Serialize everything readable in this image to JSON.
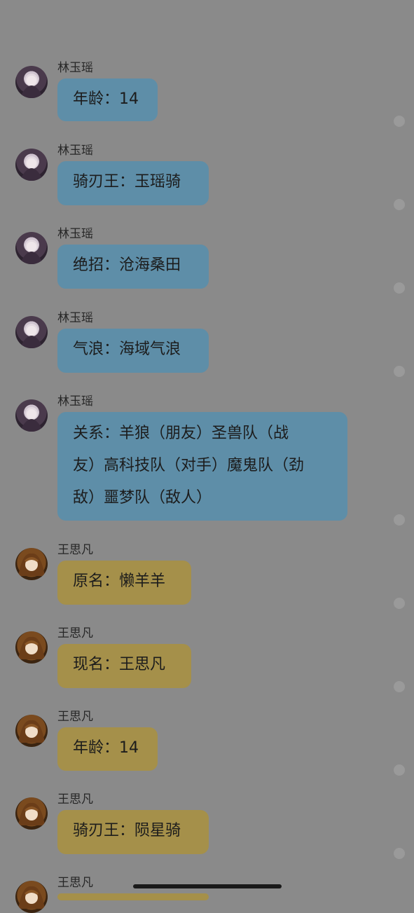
{
  "messages": [
    {
      "name": "林玉瑶",
      "text": "年龄：14",
      "avatar": "purple"
    },
    {
      "name": "林玉瑶",
      "text": "骑刃王：玉瑶骑",
      "avatar": "purple"
    },
    {
      "name": "林玉瑶",
      "text": "绝招：沧海桑田",
      "avatar": "purple"
    },
    {
      "name": "林玉瑶",
      "text": "气浪：海域气浪",
      "avatar": "purple"
    },
    {
      "name": "林玉瑶",
      "lines": [
        "关系：羊狼（朋友）圣兽队（战",
        "友）高科技队（对手）魔鬼队（劲",
        "敌）噩梦队（敌人）"
      ],
      "avatar": "purple"
    },
    {
      "name": "王思凡",
      "text": "原名：懒羊羊",
      "avatar": "amber"
    },
    {
      "name": "王思凡",
      "text": "现名：王思凡",
      "avatar": "amber"
    },
    {
      "name": "王思凡",
      "text": "年龄：14",
      "avatar": "amber"
    },
    {
      "name": "王思凡",
      "text": "骑刃王：陨星骑",
      "avatar": "amber"
    },
    {
      "name": "王思凡",
      "avatar": "amber"
    }
  ],
  "colors": {
    "background": "#8a8a8a",
    "bubble_blue": "#5e8ea8",
    "bubble_gold": "#a5904a"
  }
}
